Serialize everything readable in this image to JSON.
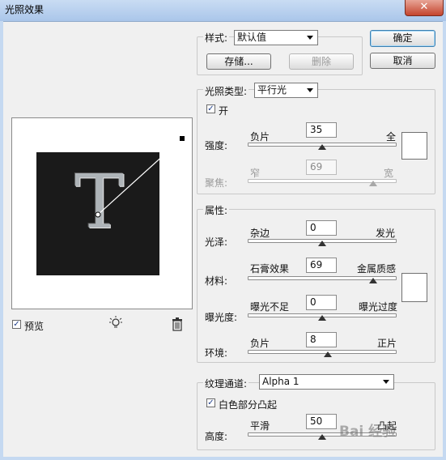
{
  "window": {
    "title": "光照效果",
    "close_glyph": "✕"
  },
  "buttons": {
    "ok": "确定",
    "cancel": "取消"
  },
  "style": {
    "label": "样式:",
    "selected": "默认值",
    "save": "存储...",
    "delete": "删除"
  },
  "light": {
    "type_label": "光照类型:",
    "type_selected": "平行光",
    "on_label": "开",
    "on_checked": true,
    "intensity": {
      "label": "强度:",
      "min_label": "负片",
      "max_label": "全",
      "value": "35",
      "fraction": 0.5
    },
    "focus": {
      "label": "聚焦:",
      "min_label": "窄",
      "max_label": "宽",
      "value": "69",
      "fraction": 0.84
    },
    "color": "#ffffff"
  },
  "properties": {
    "label": "属性:",
    "gloss": {
      "label": "光泽:",
      "min_label": "杂边",
      "max_label": "发光",
      "value": "0",
      "fraction": 0.5
    },
    "material": {
      "label": "材料:",
      "min_label": "石膏效果",
      "max_label": "金属质感",
      "value": "69",
      "fraction": 0.84
    },
    "exposure": {
      "label": "曝光度:",
      "min_label": "曝光不足",
      "max_label": "曝光过度",
      "value": "0",
      "fraction": 0.5
    },
    "ambience": {
      "label": "环境:",
      "min_label": "负片",
      "max_label": "正片",
      "value": "8",
      "fraction": 0.54
    },
    "color": "#ffffff"
  },
  "texture": {
    "channel_label": "纹理通道:",
    "channel_selected": "Alpha 1",
    "white_high_label": "白色部分凸起",
    "white_high_checked": true,
    "height": {
      "label": "高度:",
      "min_label": "平滑",
      "max_label": "凸起",
      "value": "50",
      "fraction": 0.5
    }
  },
  "preview": {
    "checkbox_label": "预览",
    "checked": true,
    "glyph": "T",
    "canvas_color": "#1a1a1a",
    "light_icon": "light-bulb-icon",
    "trash_icon": "trash-icon"
  },
  "watermark": "Bai 经验"
}
